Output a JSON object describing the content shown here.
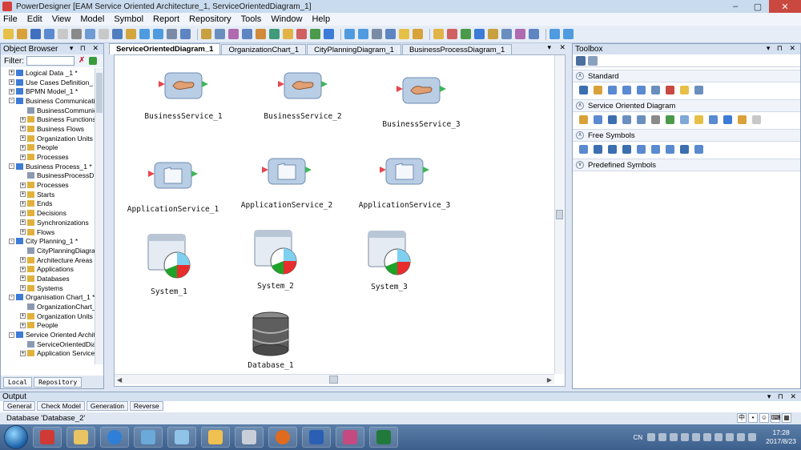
{
  "window": {
    "title": "PowerDesigner [EAM Service Oriented Architecture_1, ServiceOrientedDiagram_1]",
    "controls": [
      "–",
      "▢",
      "✕"
    ]
  },
  "menu": [
    "File",
    "Edit",
    "View",
    "Model",
    "Symbol",
    "Report",
    "Repository",
    "Tools",
    "Window",
    "Help"
  ],
  "object_browser": {
    "title": "Object Browser",
    "filter_label": "Filter:",
    "tree": [
      {
        "depth": 0,
        "exp": "+",
        "label": "Logical Data _1 *"
      },
      {
        "depth": 0,
        "exp": "+",
        "label": "Use Cases Definition_"
      },
      {
        "depth": 0,
        "exp": "+",
        "label": "BPMN Model_1 *"
      },
      {
        "depth": 0,
        "exp": "-",
        "label": "Business Communicati"
      },
      {
        "depth": 1,
        "exp": "",
        "label": "BusinessCommunic"
      },
      {
        "depth": 1,
        "exp": "+",
        "label": "Business Functions"
      },
      {
        "depth": 1,
        "exp": "+",
        "label": "Business Flows"
      },
      {
        "depth": 1,
        "exp": "+",
        "label": "Organization Units"
      },
      {
        "depth": 1,
        "exp": "+",
        "label": "People"
      },
      {
        "depth": 1,
        "exp": "+",
        "label": "Processes"
      },
      {
        "depth": 0,
        "exp": "-",
        "label": "Business Process_1 *"
      },
      {
        "depth": 1,
        "exp": "",
        "label": "BusinessProcessD"
      },
      {
        "depth": 1,
        "exp": "+",
        "label": "Processes"
      },
      {
        "depth": 1,
        "exp": "+",
        "label": "Starts"
      },
      {
        "depth": 1,
        "exp": "+",
        "label": "Ends"
      },
      {
        "depth": 1,
        "exp": "+",
        "label": "Decisions"
      },
      {
        "depth": 1,
        "exp": "+",
        "label": "Synchronizations"
      },
      {
        "depth": 1,
        "exp": "+",
        "label": "Flows"
      },
      {
        "depth": 0,
        "exp": "-",
        "label": "City Planning_1 *"
      },
      {
        "depth": 1,
        "exp": "",
        "label": "CityPlanningDiagra"
      },
      {
        "depth": 1,
        "exp": "+",
        "label": "Architecture Areas"
      },
      {
        "depth": 1,
        "exp": "+",
        "label": "Applications"
      },
      {
        "depth": 1,
        "exp": "+",
        "label": "Databases"
      },
      {
        "depth": 1,
        "exp": "+",
        "label": "Systems"
      },
      {
        "depth": 0,
        "exp": "-",
        "label": "Organisation Chart_1 *"
      },
      {
        "depth": 1,
        "exp": "",
        "label": "OrganizationChart_"
      },
      {
        "depth": 1,
        "exp": "+",
        "label": "Organization Units"
      },
      {
        "depth": 1,
        "exp": "+",
        "label": "People"
      },
      {
        "depth": 0,
        "exp": "-",
        "label": "Service Oriented Archit"
      },
      {
        "depth": 1,
        "exp": "",
        "label": "ServiceOrientedDia"
      },
      {
        "depth": 1,
        "exp": "+",
        "label": "Application Service"
      }
    ],
    "tabs": [
      "Local",
      "Repository"
    ]
  },
  "doc_tabs": [
    {
      "label": "ServiceOrientedDiagram_1",
      "active": true
    },
    {
      "label": "OrganizationChart_1",
      "active": false
    },
    {
      "label": "CityPlanningDiagram_1",
      "active": false
    },
    {
      "label": "BusinessProcessDiagram_1",
      "active": false
    }
  ],
  "symbols": {
    "business_services": [
      "BusinessService_1",
      "BusinessService_2",
      "BusinessService_3"
    ],
    "application_services": [
      "ApplicationService_1",
      "ApplicationService_2",
      "ApplicationService_3"
    ],
    "systems": [
      "System_1",
      "System_2",
      "System_3"
    ],
    "databases": [
      "Database_1"
    ]
  },
  "toolbox": {
    "title": "Toolbox",
    "sections": [
      {
        "label": "Standard",
        "expanded": true
      },
      {
        "label": "Service Oriented Diagram",
        "expanded": true
      },
      {
        "label": "Free Symbols",
        "expanded": true
      },
      {
        "label": "Predefined Symbols",
        "expanded": false
      }
    ]
  },
  "output": {
    "title": "Output",
    "tabs": [
      "General",
      "Check Model",
      "Generation",
      "Reverse"
    ]
  },
  "status": {
    "text": "Database 'Database_2'"
  },
  "tray": {
    "lang": "CN",
    "time": "17:28",
    "date": "2017/8/23"
  },
  "ime": [
    "中",
    "•",
    "☺",
    "⌨",
    "▦"
  ]
}
